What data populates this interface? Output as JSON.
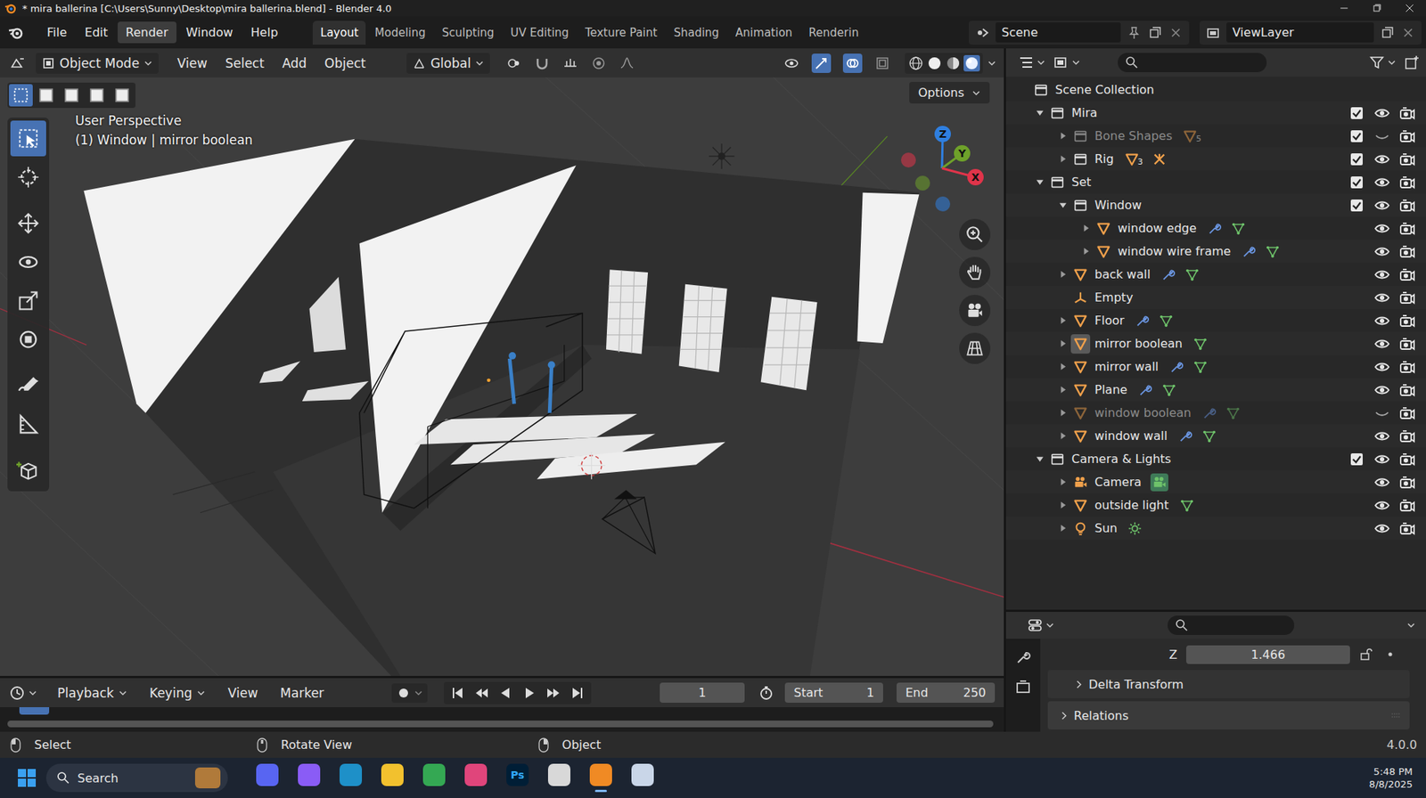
{
  "window": {
    "title": "* mira ballerina [C:\\Users\\Sunny\\Desktop\\mira ballerina.blend] - Blender 4.0"
  },
  "menus": [
    {
      "label": "File",
      "selected": false
    },
    {
      "label": "Edit",
      "selected": false
    },
    {
      "label": "Render",
      "selected": true
    },
    {
      "label": "Window",
      "selected": false
    },
    {
      "label": "Help",
      "selected": false
    }
  ],
  "workspaces": [
    {
      "label": "Layout",
      "selected": true
    },
    {
      "label": "Modeling",
      "selected": false
    },
    {
      "label": "Sculpting",
      "selected": false
    },
    {
      "label": "UV Editing",
      "selected": false
    },
    {
      "label": "Texture Paint",
      "selected": false
    },
    {
      "label": "Shading",
      "selected": false
    },
    {
      "label": "Animation",
      "selected": false
    },
    {
      "label": "Renderin",
      "selected": false
    }
  ],
  "scene": "Scene",
  "view_layer": "ViewLayer",
  "viewport_header": {
    "mode": "Object Mode",
    "menus": [
      "View",
      "Select",
      "Add",
      "Object"
    ],
    "orientation": "Global",
    "options": "Options"
  },
  "viewport": {
    "perspective": "User Perspective",
    "context": "(1) Window | mirror boolean",
    "axes": [
      {
        "label": "Z",
        "color": "#2f7fe0"
      },
      {
        "label": "Y",
        "color": "#6ea12a"
      },
      {
        "label": "X",
        "color": "#e0344a"
      }
    ],
    "tools": [
      {
        "kind": "select",
        "selected": true
      },
      {
        "kind": "cursor",
        "selected": false
      },
      {
        "kind": "move",
        "selected": false
      },
      {
        "kind": "rotate",
        "selected": false
      },
      {
        "kind": "scale",
        "selected": false
      },
      {
        "kind": "transform",
        "selected": false
      },
      {
        "kind": "annotate",
        "selected": false
      },
      {
        "kind": "measure",
        "selected": false
      },
      {
        "kind": "add-cube",
        "selected": false
      }
    ],
    "select_modes": [
      {
        "selected": true
      },
      {
        "selected": false
      },
      {
        "selected": false
      },
      {
        "selected": false
      },
      {
        "selected": false
      }
    ]
  },
  "outliner": {
    "rows": [
      {
        "name": "Scene Collection",
        "depth": 0,
        "kind": "scene",
        "arrow": "none",
        "greyed": false,
        "active": false,
        "badges": []
      },
      {
        "name": "Mira",
        "depth": 1,
        "kind": "collection",
        "arrow": "open",
        "checked": true,
        "visible": true,
        "greyed": false,
        "active": false,
        "badges": []
      },
      {
        "name": "Bone Shapes",
        "depth": 2,
        "kind": "collection",
        "arrow": "closed",
        "checked": true,
        "visible": false,
        "greyed": true,
        "active": false,
        "badges": [
          {
            "kind": "objects",
            "count": "5",
            "active": false
          }
        ]
      },
      {
        "name": "Rig",
        "depth": 2,
        "kind": "collection",
        "arrow": "closed",
        "checked": true,
        "visible": true,
        "greyed": false,
        "active": false,
        "badges": [
          {
            "kind": "objects",
            "count": "3",
            "active": false
          },
          {
            "kind": "armature",
            "active": false
          }
        ]
      },
      {
        "name": "Set",
        "depth": 1,
        "kind": "collection",
        "arrow": "open",
        "checked": true,
        "visible": true,
        "greyed": false,
        "active": false,
        "badges": []
      },
      {
        "name": "Window",
        "depth": 2,
        "kind": "collection",
        "arrow": "open",
        "checked": true,
        "visible": true,
        "greyed": false,
        "active": false,
        "badges": []
      },
      {
        "name": "window edge",
        "depth": 3,
        "kind": "mesh",
        "arrow": "closed",
        "visible": true,
        "greyed": false,
        "active": false,
        "badges": [
          {
            "kind": "modifier",
            "active": false
          },
          {
            "kind": "mesh",
            "active": false
          }
        ]
      },
      {
        "name": "window wire frame",
        "depth": 3,
        "kind": "mesh",
        "arrow": "closed",
        "visible": true,
        "greyed": false,
        "active": false,
        "badges": [
          {
            "kind": "modifier",
            "active": false
          },
          {
            "kind": "mesh",
            "active": false
          }
        ]
      },
      {
        "name": "back wall",
        "depth": 2,
        "kind": "mesh",
        "arrow": "closed",
        "visible": true,
        "greyed": false,
        "active": false,
        "badges": [
          {
            "kind": "modifier",
            "active": false
          },
          {
            "kind": "mesh",
            "active": false
          }
        ]
      },
      {
        "name": "Empty",
        "depth": 2,
        "kind": "empty",
        "arrow": "none",
        "visible": true,
        "greyed": false,
        "active": false,
        "badges": []
      },
      {
        "name": "Floor",
        "depth": 2,
        "kind": "mesh",
        "arrow": "closed",
        "visible": true,
        "greyed": false,
        "active": false,
        "badges": [
          {
            "kind": "modifier",
            "active": false
          },
          {
            "kind": "mesh",
            "active": false
          }
        ]
      },
      {
        "name": "mirror boolean",
        "depth": 2,
        "kind": "mesh",
        "arrow": "closed",
        "visible": true,
        "greyed": false,
        "active": true,
        "badges": [
          {
            "kind": "mesh",
            "active": false
          }
        ]
      },
      {
        "name": "mirror wall",
        "depth": 2,
        "kind": "mesh",
        "arrow": "closed",
        "visible": true,
        "greyed": false,
        "active": false,
        "badges": [
          {
            "kind": "modifier",
            "active": false
          },
          {
            "kind": "mesh",
            "active": false
          }
        ]
      },
      {
        "name": "Plane",
        "depth": 2,
        "kind": "mesh",
        "arrow": "closed",
        "visible": true,
        "greyed": false,
        "active": false,
        "badges": [
          {
            "kind": "modifier",
            "active": false
          },
          {
            "kind": "mesh",
            "active": false
          }
        ]
      },
      {
        "name": "window boolean",
        "depth": 2,
        "kind": "mesh",
        "arrow": "closed",
        "visible": false,
        "greyed": true,
        "active": false,
        "badges": [
          {
            "kind": "modifier",
            "active": false
          },
          {
            "kind": "mesh",
            "active": false
          }
        ]
      },
      {
        "name": "window wall",
        "depth": 2,
        "kind": "mesh",
        "arrow": "closed",
        "visible": true,
        "greyed": false,
        "active": false,
        "badges": [
          {
            "kind": "modifier",
            "active": false
          },
          {
            "kind": "mesh",
            "active": false
          }
        ]
      },
      {
        "name": "Camera & Lights",
        "depth": 1,
        "kind": "collection",
        "arrow": "open",
        "checked": true,
        "visible": true,
        "greyed": false,
        "active": false,
        "badges": []
      },
      {
        "name": "Camera",
        "depth": 2,
        "kind": "camera",
        "arrow": "closed",
        "visible": true,
        "greyed": false,
        "active": false,
        "badges": [
          {
            "kind": "camera",
            "active": true
          }
        ]
      },
      {
        "name": "outside light",
        "depth": 2,
        "kind": "mesh",
        "arrow": "closed",
        "visible": true,
        "greyed": false,
        "active": false,
        "badges": [
          {
            "kind": "mesh",
            "active": false
          }
        ]
      },
      {
        "name": "Sun",
        "depth": 2,
        "kind": "light",
        "arrow": "closed",
        "visible": true,
        "greyed": false,
        "active": false,
        "badges": [
          {
            "kind": "sun",
            "active": false
          }
        ]
      }
    ]
  },
  "properties": {
    "field": {
      "label": "Z",
      "value": "1.466"
    },
    "panels": [
      {
        "label": "Delta Transform",
        "depth": 1,
        "expanded": false
      },
      {
        "label": "Relations",
        "depth": 0,
        "expanded": false
      }
    ]
  },
  "timeline": {
    "menus": [
      {
        "label": "Playback",
        "dropdown": true
      },
      {
        "label": "Keying",
        "dropdown": true
      },
      {
        "label": "View",
        "dropdown": false
      },
      {
        "label": "Marker",
        "dropdown": false
      }
    ],
    "frame": "1",
    "start": {
      "label": "Start",
      "value": "1"
    },
    "end": {
      "label": "End",
      "value": "250"
    }
  },
  "status_bar": {
    "hints": [
      "Select",
      "Rotate View",
      "Object"
    ],
    "version": "4.0.0"
  },
  "taskbar": {
    "search": "Search",
    "time": "5:48 PM",
    "date": "8/8/2025",
    "apps": [
      {
        "color": "#5865f2",
        "selected": false
      },
      {
        "color": "#8a5cf6",
        "selected": false
      },
      {
        "color": "#1e90c8",
        "selected": false
      },
      {
        "color": "#f2c12e",
        "selected": false
      },
      {
        "color": "#34a853",
        "selected": false
      },
      {
        "color": "#e0457b",
        "selected": false
      },
      {
        "color": "#001e36",
        "label": "Ps",
        "selected": false
      },
      {
        "color": "#d8d8d8",
        "selected": false
      },
      {
        "color": "#f08a24",
        "selected": true
      },
      {
        "color": "#c9d6e8",
        "selected": false
      }
    ]
  }
}
